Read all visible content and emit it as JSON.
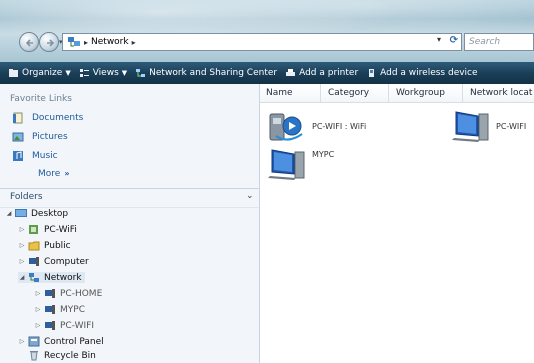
{
  "address_bar": {
    "location": "Network",
    "search_placeholder": "Search"
  },
  "toolbar": {
    "organize": "Organize",
    "views": "Views",
    "network_sharing": "Network and Sharing Center",
    "add_printer": "Add a printer",
    "add_wireless": "Add a wireless device"
  },
  "sidebar": {
    "favorites_header": "Favorite Links",
    "favorites": [
      {
        "label": "Documents",
        "icon": "documents-icon"
      },
      {
        "label": "Pictures",
        "icon": "pictures-icon"
      },
      {
        "label": "Music",
        "icon": "music-icon"
      }
    ],
    "more": "More",
    "more_arrow": "»",
    "folders_label": "Folders",
    "tree": [
      {
        "label": "Desktop",
        "icon": "desktop-icon"
      },
      {
        "label": "PC-WiFi",
        "icon": "pc-icon"
      },
      {
        "label": "Public",
        "icon": "folder-icon"
      },
      {
        "label": "Computer",
        "icon": "computer-icon"
      },
      {
        "label": "Network",
        "icon": "network-icon"
      },
      {
        "label": "PC-HOME",
        "icon": "network-pc-icon"
      },
      {
        "label": "MYPC",
        "icon": "network-pc-icon"
      },
      {
        "label": "PC-WIFI",
        "icon": "network-pc-icon"
      },
      {
        "label": "Control Panel",
        "icon": "control-panel-icon"
      },
      {
        "label": "Recycle Bin",
        "icon": "recycle-bin-icon"
      }
    ]
  },
  "content": {
    "columns": [
      "Name",
      "Category",
      "Workgroup",
      "Network locat"
    ],
    "items": [
      {
        "label": "PC-WIFI : WiFi",
        "icon": "media-device-icon"
      },
      {
        "label": "PC-WIFI",
        "icon": "network-computer-icon"
      },
      {
        "label": "MYPC",
        "icon": "network-computer-icon"
      }
    ]
  },
  "colors": {
    "toolbar": "#1b3f59",
    "link": "#1d5a9a",
    "sidebar_bg": "#f2f6fa"
  }
}
